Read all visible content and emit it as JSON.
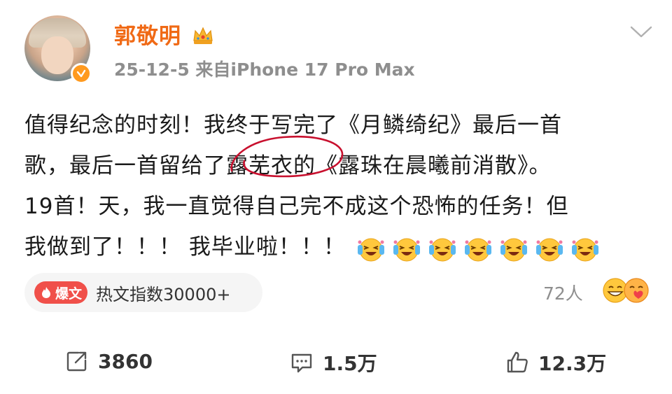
{
  "header": {
    "username": "郭敬明",
    "meta": "25-12-5  来自iPhone 17 Pro Max",
    "avatar_icon": "avatar-photo",
    "verified_icon": "verified-badge-icon",
    "crown_icon": "crown-icon",
    "menu_icon": "chevron-down-icon"
  },
  "post": {
    "line1": "值得纪念的时刻！我终于写完了《月鳞绮纪》最后一首",
    "line2": "歌，最后一首留给了露芜衣的《露珠在晨曦前消散》。",
    "line3": "19首！天，我一直觉得自己完不成这个恐怖的任务！但",
    "line4": "我做到了！！！ 我毕业啦！！！",
    "emoji_count": 7,
    "emoji_icon": "crying-laughing-emoji-icon"
  },
  "hot": {
    "tag_label": "爆文",
    "text": "热文指数30000+"
  },
  "reactions": {
    "count": "72人"
  },
  "actions": {
    "repost": "3860",
    "comment": "1.5万",
    "like": "12.3万"
  },
  "colors": {
    "username": "#f06a16",
    "hot_tag": "#f0504a",
    "verified": "#ff9a1f",
    "annotation": "#c8102e"
  }
}
